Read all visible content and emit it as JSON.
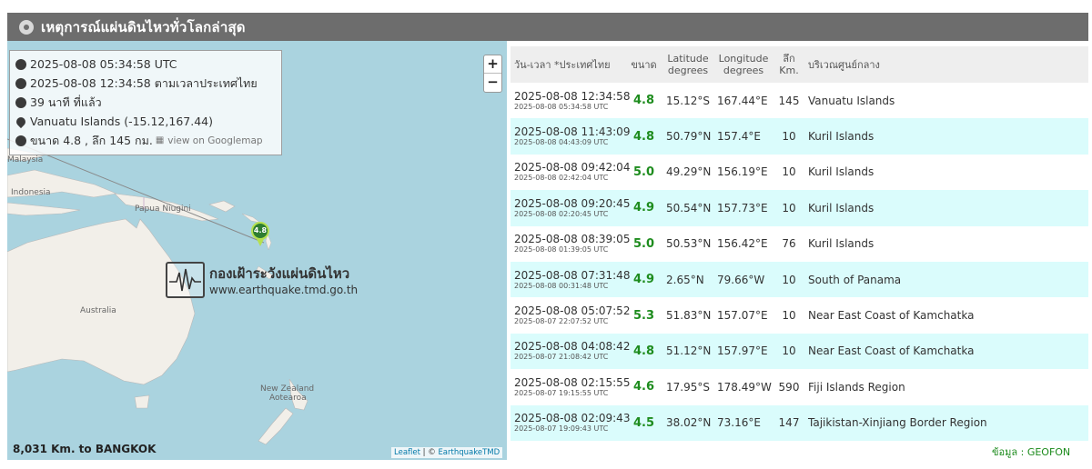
{
  "header": {
    "title": "เหตุการณ์แผ่นดินไหวทั่วโลกล่าสุด"
  },
  "info": {
    "utc_time": "2025-08-08 05:34:58 UTC",
    "thai_time": "2025-08-08 12:34:58 ตามเวลาประเทศไทย",
    "elapsed": "39 นาที ที่แล้ว",
    "location": "Vanuatu Islands (-15.12,167.44)",
    "summary": "ขนาด 4.8 , ลึก 145 กม.",
    "googlemap_link": "view on Googlemap"
  },
  "map": {
    "zoom_in": "+",
    "zoom_out": "−",
    "labels": {
      "malaysia": "Malaysia",
      "indonesia": "Indonesia",
      "papua": "Papua Niugini",
      "australia": "Australia",
      "nz1": "New Zealand",
      "nz2": "Aotearoa"
    },
    "marker_label": "4.8",
    "watermark_title": "กองเฝ้าระวังแผ่นดินไหว",
    "watermark_url": "www.earthquake.tmd.go.th",
    "distance": "8,031 Km. to BANGKOK",
    "attr_leaflet": "Leaflet",
    "attr_sep": " | © ",
    "attr_tmd": "EarthquakeTMD"
  },
  "table": {
    "headers": {
      "time": "วัน-เวลา *ประเทศไทย",
      "mag": "ขนาด",
      "lat1": "Latitude",
      "lat2": "degrees",
      "lon1": "Longitude",
      "lon2": "degrees",
      "depth1": "ลึก",
      "depth2": "Km.",
      "region": "บริเวณศูนย์กลาง"
    },
    "rows": [
      {
        "thai": "2025-08-08 12:34:58",
        "utc": "2025-08-08 05:34:58 UTC",
        "mag": "4.8",
        "lat": "15.12°S",
        "lon": "167.44°E",
        "depth": "145",
        "region": "Vanuatu Islands"
      },
      {
        "thai": "2025-08-08 11:43:09",
        "utc": "2025-08-08 04:43:09 UTC",
        "mag": "4.8",
        "lat": "50.79°N",
        "lon": "157.4°E",
        "depth": "10",
        "region": "Kuril Islands"
      },
      {
        "thai": "2025-08-08 09:42:04",
        "utc": "2025-08-08 02:42:04 UTC",
        "mag": "5.0",
        "lat": "49.29°N",
        "lon": "156.19°E",
        "depth": "10",
        "region": "Kuril Islands"
      },
      {
        "thai": "2025-08-08 09:20:45",
        "utc": "2025-08-08 02:20:45 UTC",
        "mag": "4.9",
        "lat": "50.54°N",
        "lon": "157.73°E",
        "depth": "10",
        "region": "Kuril Islands"
      },
      {
        "thai": "2025-08-08 08:39:05",
        "utc": "2025-08-08 01:39:05 UTC",
        "mag": "5.0",
        "lat": "50.53°N",
        "lon": "156.42°E",
        "depth": "76",
        "region": "Kuril Islands"
      },
      {
        "thai": "2025-08-08 07:31:48",
        "utc": "2025-08-08 00:31:48 UTC",
        "mag": "4.9",
        "lat": "2.65°N",
        "lon": "79.66°W",
        "depth": "10",
        "region": "South of Panama"
      },
      {
        "thai": "2025-08-08 05:07:52",
        "utc": "2025-08-07 22:07:52 UTC",
        "mag": "5.3",
        "lat": "51.83°N",
        "lon": "157.07°E",
        "depth": "10",
        "region": "Near East Coast of Kamchatka"
      },
      {
        "thai": "2025-08-08 04:08:42",
        "utc": "2025-08-07 21:08:42 UTC",
        "mag": "4.8",
        "lat": "51.12°N",
        "lon": "157.97°E",
        "depth": "10",
        "region": "Near East Coast of Kamchatka"
      },
      {
        "thai": "2025-08-08 02:15:55",
        "utc": "2025-08-07 19:15:55 UTC",
        "mag": "4.6",
        "lat": "17.95°S",
        "lon": "178.49°W",
        "depth": "590",
        "region": "Fiji Islands Region"
      },
      {
        "thai": "2025-08-08 02:09:43",
        "utc": "2025-08-07 19:09:43 UTC",
        "mag": "4.5",
        "lat": "38.02°N",
        "lon": "73.16°E",
        "depth": "147",
        "region": "Tajikistan-Xinjiang Border Region"
      }
    ]
  },
  "source": "ข้อมูล : GEOFON",
  "colors": {
    "header_bg": "#6d6d6d",
    "row_alt": "#dafcfc",
    "magnitude": "#1e8c1e",
    "sea": "#aad3df",
    "land": "#f2efe9"
  }
}
